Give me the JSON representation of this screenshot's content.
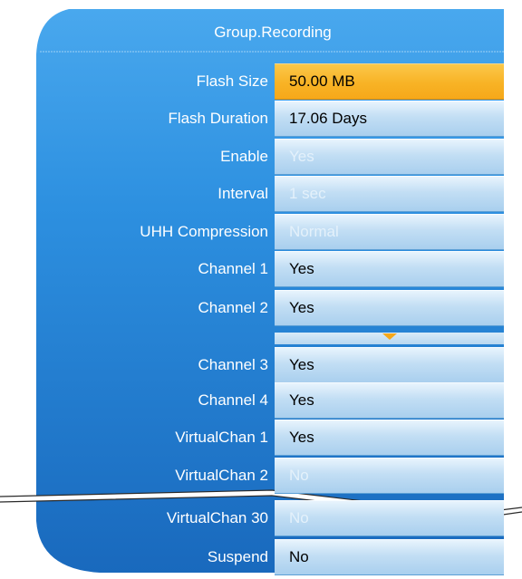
{
  "header": {
    "title": "Group.Recording"
  },
  "rows": [
    {
      "label": "Flash Size",
      "value": "50.00 MB"
    },
    {
      "label": "Flash Duration",
      "value": "17.06 Days"
    },
    {
      "label": "Enable",
      "value": "Yes"
    },
    {
      "label": "Interval",
      "value": "1 sec"
    },
    {
      "label": "UHH Compression",
      "value": "Normal"
    },
    {
      "label": "Channel 1",
      "value": "Yes"
    },
    {
      "label": "Channel 2",
      "value": "Yes"
    },
    {
      "label": "Channel 3",
      "value": "Yes"
    },
    {
      "label": "Channel 4",
      "value": "Yes"
    },
    {
      "label": "VirtualChan 1",
      "value": "Yes"
    },
    {
      "label": "VirtualChan 2",
      "value": "No"
    },
    {
      "label": "VirtualChan 30",
      "value": "No"
    },
    {
      "label": "Suspend",
      "value": "No"
    }
  ],
  "colors": {
    "panel_blue": "#2a8fe0",
    "panel_dark": "#1666b6",
    "selected": "#f8b325",
    "value_field": "#c2def4"
  },
  "icons": {
    "scroll": "chevron-down-icon"
  }
}
